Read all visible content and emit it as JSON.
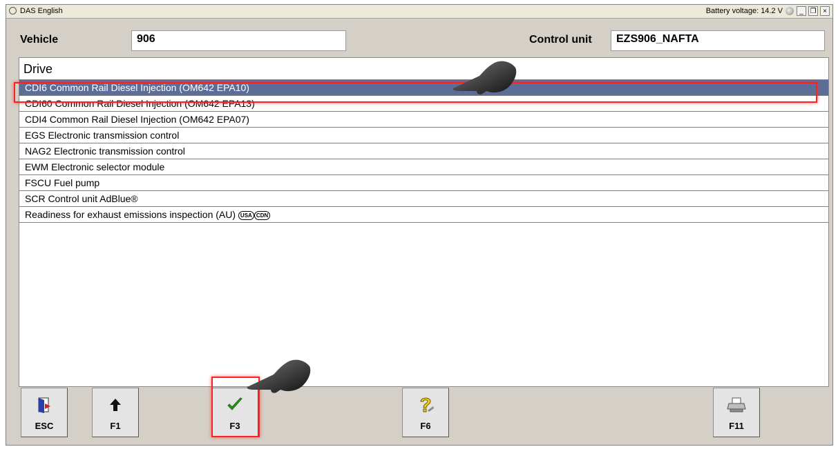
{
  "window": {
    "title": "DAS English",
    "battery_label": "Battery voltage: 14.2 V",
    "controls": {
      "minimize": "_",
      "restore": "̅❐",
      "close": "×"
    }
  },
  "header": {
    "vehicle_label": "Vehicle",
    "vehicle_value": "906",
    "control_unit_label": "Control unit",
    "control_unit_value": "EZS906_NAFTA"
  },
  "panel": {
    "title": "Drive",
    "items": [
      {
        "label": "CDI6 Common Rail Diesel Injection (OM642 EPA10)",
        "selected": true
      },
      {
        "label": "CDI60 Common Rail Diesel Injection (OM642 EPA13)",
        "selected": false
      },
      {
        "label": "CDI4 Common Rail Diesel Injection (OM642 EPA07)",
        "selected": false
      },
      {
        "label": "EGS Electronic transmission control",
        "selected": false
      },
      {
        "label": "NAG2 Electronic transmission control",
        "selected": false
      },
      {
        "label": "EWM Electronic selector module",
        "selected": false
      },
      {
        "label": "FSCU Fuel pump",
        "selected": false
      },
      {
        "label": "SCR Control unit AdBlue®",
        "selected": false
      },
      {
        "label": "Readiness for exhaust emissions inspection (AU)",
        "selected": false,
        "badges": [
          "USA",
          "CDN"
        ]
      }
    ]
  },
  "buttons": {
    "esc": {
      "label": "ESC",
      "icon": "exit-door-icon"
    },
    "f1": {
      "label": "F1",
      "icon": "arrow-up-icon"
    },
    "f3": {
      "label": "F3",
      "icon": "checkmark-icon"
    },
    "f6": {
      "label": "F6",
      "icon": "help-question-icon"
    },
    "f11": {
      "label": "F11",
      "icon": "printer-icon"
    }
  },
  "colors": {
    "selected_row": "#5c6d98",
    "highlight_box": "#ff2020",
    "checkmark": "#2a9a1a"
  }
}
